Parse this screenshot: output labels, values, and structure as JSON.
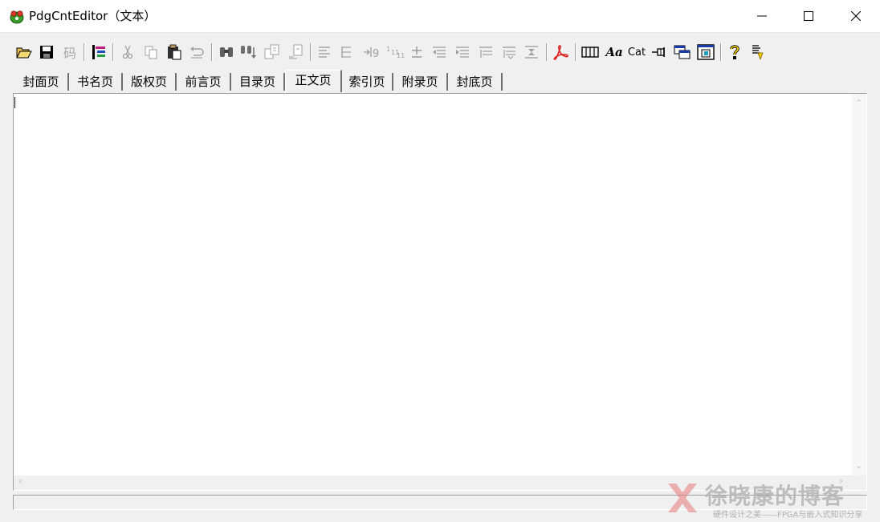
{
  "window": {
    "title": "PdgCntEditor（文本）",
    "minimize_icon": "minimize-icon",
    "maximize_icon": "maximize-icon",
    "close_icon": "close-icon"
  },
  "toolbar": {
    "ma_label": "码",
    "cat_label": "Cat",
    "aa_label": "Aa"
  },
  "tabs": [
    {
      "label": "封面页"
    },
    {
      "label": "书名页"
    },
    {
      "label": "版权页"
    },
    {
      "label": "前言页"
    },
    {
      "label": "目录页"
    },
    {
      "label": "正文页"
    },
    {
      "label": "索引页"
    },
    {
      "label": "附录页"
    },
    {
      "label": "封底页"
    }
  ],
  "active_tab": "正文页",
  "editor": {
    "content": ""
  },
  "watermark": {
    "title": "徐晓康的博客",
    "subtitle": "硬件设计之美——FPGA与嵌入式知识分享"
  },
  "colors": {
    "titlebar_bg": "#ffffff",
    "window_bg": "#f0f0f0",
    "editor_bg": "#ffffff",
    "acrobat_red": "#e02020",
    "help_yellow": "#f0d000"
  }
}
